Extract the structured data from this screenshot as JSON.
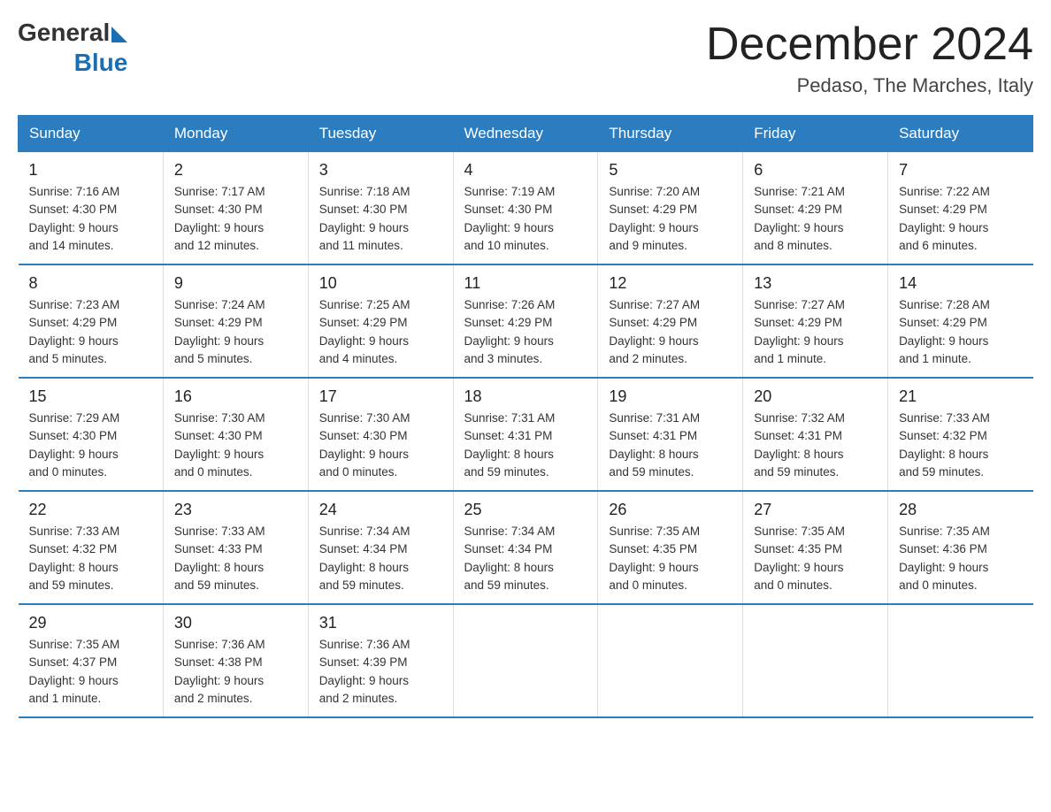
{
  "header": {
    "logo_general": "General",
    "logo_blue": "Blue",
    "month_title": "December 2024",
    "location": "Pedaso, The Marches, Italy"
  },
  "days_of_week": [
    "Sunday",
    "Monday",
    "Tuesday",
    "Wednesday",
    "Thursday",
    "Friday",
    "Saturday"
  ],
  "weeks": [
    [
      {
        "day": "1",
        "sunrise": "7:16 AM",
        "sunset": "4:30 PM",
        "daylight": "9 hours and 14 minutes."
      },
      {
        "day": "2",
        "sunrise": "7:17 AM",
        "sunset": "4:30 PM",
        "daylight": "9 hours and 12 minutes."
      },
      {
        "day": "3",
        "sunrise": "7:18 AM",
        "sunset": "4:30 PM",
        "daylight": "9 hours and 11 minutes."
      },
      {
        "day": "4",
        "sunrise": "7:19 AM",
        "sunset": "4:30 PM",
        "daylight": "9 hours and 10 minutes."
      },
      {
        "day": "5",
        "sunrise": "7:20 AM",
        "sunset": "4:29 PM",
        "daylight": "9 hours and 9 minutes."
      },
      {
        "day": "6",
        "sunrise": "7:21 AM",
        "sunset": "4:29 PM",
        "daylight": "9 hours and 8 minutes."
      },
      {
        "day": "7",
        "sunrise": "7:22 AM",
        "sunset": "4:29 PM",
        "daylight": "9 hours and 6 minutes."
      }
    ],
    [
      {
        "day": "8",
        "sunrise": "7:23 AM",
        "sunset": "4:29 PM",
        "daylight": "9 hours and 5 minutes."
      },
      {
        "day": "9",
        "sunrise": "7:24 AM",
        "sunset": "4:29 PM",
        "daylight": "9 hours and 5 minutes."
      },
      {
        "day": "10",
        "sunrise": "7:25 AM",
        "sunset": "4:29 PM",
        "daylight": "9 hours and 4 minutes."
      },
      {
        "day": "11",
        "sunrise": "7:26 AM",
        "sunset": "4:29 PM",
        "daylight": "9 hours and 3 minutes."
      },
      {
        "day": "12",
        "sunrise": "7:27 AM",
        "sunset": "4:29 PM",
        "daylight": "9 hours and 2 minutes."
      },
      {
        "day": "13",
        "sunrise": "7:27 AM",
        "sunset": "4:29 PM",
        "daylight": "9 hours and 1 minute."
      },
      {
        "day": "14",
        "sunrise": "7:28 AM",
        "sunset": "4:29 PM",
        "daylight": "9 hours and 1 minute."
      }
    ],
    [
      {
        "day": "15",
        "sunrise": "7:29 AM",
        "sunset": "4:30 PM",
        "daylight": "9 hours and 0 minutes."
      },
      {
        "day": "16",
        "sunrise": "7:30 AM",
        "sunset": "4:30 PM",
        "daylight": "9 hours and 0 minutes."
      },
      {
        "day": "17",
        "sunrise": "7:30 AM",
        "sunset": "4:30 PM",
        "daylight": "9 hours and 0 minutes."
      },
      {
        "day": "18",
        "sunrise": "7:31 AM",
        "sunset": "4:31 PM",
        "daylight": "8 hours and 59 minutes."
      },
      {
        "day": "19",
        "sunrise": "7:31 AM",
        "sunset": "4:31 PM",
        "daylight": "8 hours and 59 minutes."
      },
      {
        "day": "20",
        "sunrise": "7:32 AM",
        "sunset": "4:31 PM",
        "daylight": "8 hours and 59 minutes."
      },
      {
        "day": "21",
        "sunrise": "7:33 AM",
        "sunset": "4:32 PM",
        "daylight": "8 hours and 59 minutes."
      }
    ],
    [
      {
        "day": "22",
        "sunrise": "7:33 AM",
        "sunset": "4:32 PM",
        "daylight": "8 hours and 59 minutes."
      },
      {
        "day": "23",
        "sunrise": "7:33 AM",
        "sunset": "4:33 PM",
        "daylight": "8 hours and 59 minutes."
      },
      {
        "day": "24",
        "sunrise": "7:34 AM",
        "sunset": "4:34 PM",
        "daylight": "8 hours and 59 minutes."
      },
      {
        "day": "25",
        "sunrise": "7:34 AM",
        "sunset": "4:34 PM",
        "daylight": "8 hours and 59 minutes."
      },
      {
        "day": "26",
        "sunrise": "7:35 AM",
        "sunset": "4:35 PM",
        "daylight": "9 hours and 0 minutes."
      },
      {
        "day": "27",
        "sunrise": "7:35 AM",
        "sunset": "4:35 PM",
        "daylight": "9 hours and 0 minutes."
      },
      {
        "day": "28",
        "sunrise": "7:35 AM",
        "sunset": "4:36 PM",
        "daylight": "9 hours and 0 minutes."
      }
    ],
    [
      {
        "day": "29",
        "sunrise": "7:35 AM",
        "sunset": "4:37 PM",
        "daylight": "9 hours and 1 minute."
      },
      {
        "day": "30",
        "sunrise": "7:36 AM",
        "sunset": "4:38 PM",
        "daylight": "9 hours and 2 minutes."
      },
      {
        "day": "31",
        "sunrise": "7:36 AM",
        "sunset": "4:39 PM",
        "daylight": "9 hours and 2 minutes."
      },
      null,
      null,
      null,
      null
    ]
  ],
  "labels": {
    "sunrise": "Sunrise:",
    "sunset": "Sunset:",
    "daylight": "Daylight:"
  }
}
